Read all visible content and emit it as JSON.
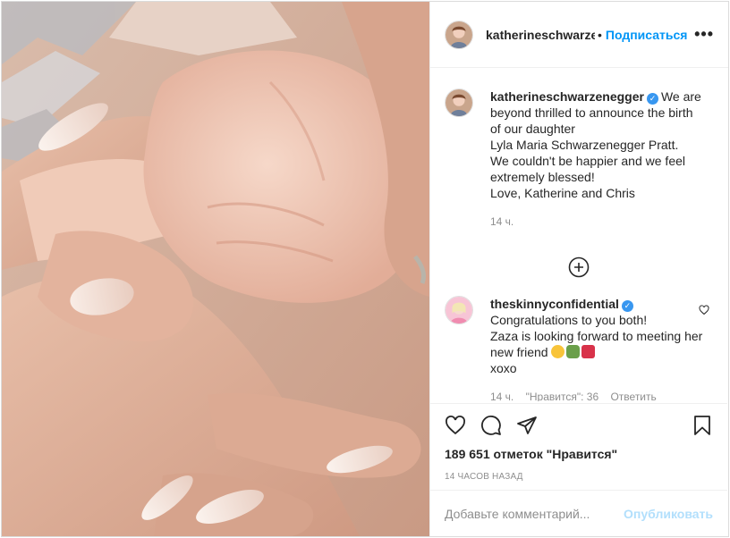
{
  "post": {
    "author": "katherineschwarzenegger",
    "separator": "•",
    "follow_label": "Подписаться",
    "more_label": "•••"
  },
  "caption": {
    "username": "katherineschwarzenegger",
    "lines": [
      "We are beyond thrilled to announce the birth of our daughter",
      "Lyla Maria Schwarzenegger Pratt.",
      "We couldn't be happier and we feel extremely blessed!",
      "Love, Katherine and Chris"
    ],
    "time": "14 ч."
  },
  "comments": [
    {
      "username": "theskinnyconfidential",
      "lines": [
        "Congratulations to you both!",
        "Zaza is looking forward to meeting her new friend",
        "xoxo"
      ],
      "time": "14 ч.",
      "likes": "\"Нравится\": 36",
      "reply_label": "Ответить"
    }
  ],
  "actions": {
    "likes_text": "189 651 отметок \"Нравится\"",
    "time_ago": "14 часов назад"
  },
  "comment_box": {
    "placeholder": "Добавьте комментарий...",
    "publish_label": "Опубликовать"
  },
  "colors": {
    "accent": "#0095f6",
    "publish_disabled": "#b2dffc",
    "verified": "#3897f0"
  },
  "icons": [
    "more-icon",
    "verified-icon",
    "load-more-icon",
    "comment-like-icon",
    "heart-icon",
    "comment-icon",
    "share-icon",
    "bookmark-icon"
  ]
}
